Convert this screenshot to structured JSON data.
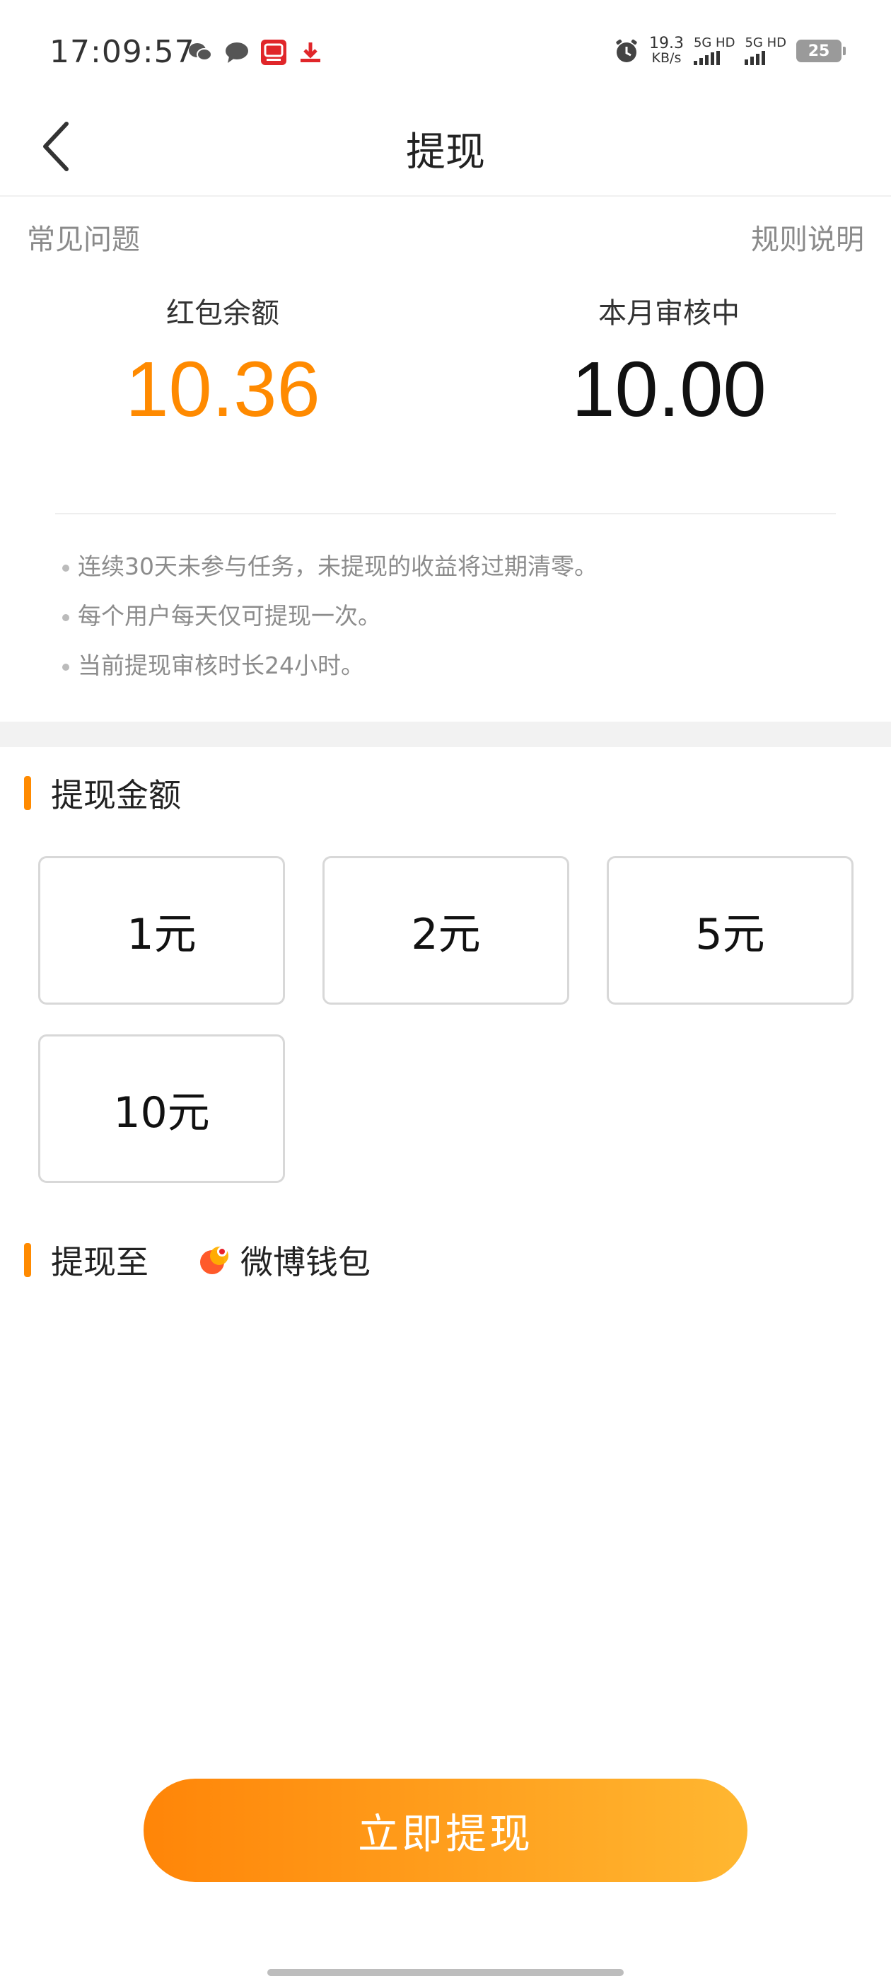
{
  "status_bar": {
    "time": "17:09:57",
    "net_speed_value": "19.3",
    "net_speed_unit": "KB/s",
    "sim1_label": "5G HD",
    "sim2_label": "5G HD",
    "battery": "25",
    "left_icons": [
      "wechat-icon",
      "message-icon",
      "taobao-icon",
      "download-icon"
    ],
    "right_icons": [
      "alarm-icon"
    ]
  },
  "nav": {
    "title": "提现",
    "back_icon": "chevron-left-icon"
  },
  "links": {
    "faq": "常见问题",
    "rules": "规则说明"
  },
  "summary": {
    "balance_label": "红包余额",
    "balance_value": "10.36",
    "pending_label": "本月审核中",
    "pending_value": "10.00",
    "accent_color": "#ff8a00"
  },
  "notes": [
    "连续30天未参与任务，未提现的收益将过期清零。",
    "每个用户每天仅可提现一次。",
    "当前提现审核时长24小时。"
  ],
  "amount_section": {
    "title": "提现金额",
    "options": [
      "1元",
      "2元",
      "5元",
      "10元"
    ]
  },
  "withdraw_to": {
    "title": "提现至",
    "wallet_name": "微博钱包",
    "wallet_icon": "weibo-wallet-icon"
  },
  "submit": {
    "label": "立即提现"
  }
}
